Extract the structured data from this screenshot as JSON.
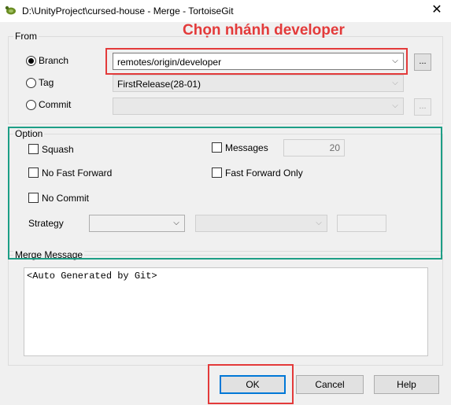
{
  "window": {
    "title": "D:\\UnityProject\\cursed-house - Merge - TortoiseGit",
    "close_glyph": "✕"
  },
  "from": {
    "label": "From",
    "branch": {
      "label": "Branch",
      "value": "remotes/origin/developer",
      "checked": true
    },
    "tag": {
      "label": "Tag",
      "value": "FirstRelease(28-01)",
      "checked": false
    },
    "commit": {
      "label": "Commit",
      "value": "",
      "checked": false
    },
    "browse_label": "..."
  },
  "option": {
    "label": "Option",
    "squash": "Squash",
    "no_fast_forward": "No Fast Forward",
    "no_commit": "No Commit",
    "messages": "Messages",
    "messages_count": "20",
    "fast_forward_only": "Fast Forward Only",
    "strategy_label": "Strategy",
    "strategy_value": "",
    "strategy_option_value": ""
  },
  "merge_message": {
    "label": "Merge Message",
    "text": "<Auto Generated by Git>"
  },
  "buttons": {
    "ok": "OK",
    "cancel": "Cancel",
    "help": "Help"
  },
  "annotation": {
    "text": "Chọn nhánh developer"
  },
  "colors": {
    "annotation_red": "#e33a3a",
    "annotation_green": "#1d9e86",
    "focus_blue": "#0078d7"
  },
  "icons": {
    "app": "tortoisegit-icon",
    "arrow": "chevron-down-icon"
  }
}
